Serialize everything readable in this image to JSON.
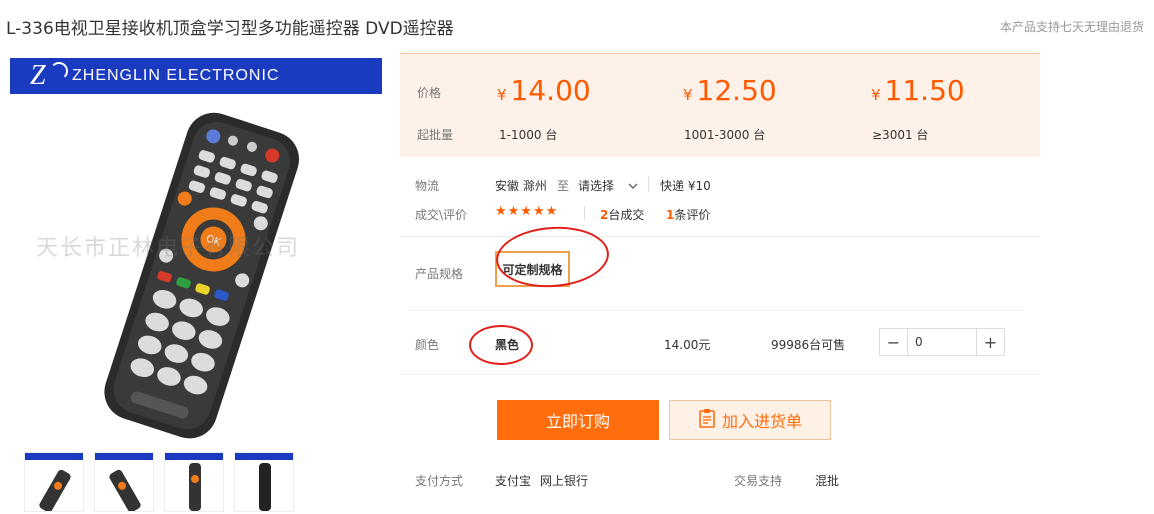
{
  "product": {
    "title": "L-336电视卫星接收机顶盒学习型多功能遥控器 DVD遥控器",
    "notice": "本产品支持七天无理由退货"
  },
  "gallery": {
    "brand": "ZHENGLIN ELECTRONIC",
    "watermark": "天长市正林电子有限公司"
  },
  "pricing": {
    "price_label": "价格",
    "moq_label": "起批量",
    "currency": "¥",
    "tiers": [
      {
        "price": "14.00",
        "range": "1-1000 台"
      },
      {
        "price": "12.50",
        "range": "1001-3000 台"
      },
      {
        "price": "11.50",
        "range": "≥3001 台"
      }
    ]
  },
  "logistics": {
    "label": "物流",
    "origin": "安徽 滁州",
    "to": "至",
    "destination": "请选择",
    "shipping": "快递 ¥10"
  },
  "trade": {
    "label": "成交\\评价",
    "stars": "★★★★★",
    "deals_count": "2",
    "deals_text": "台成交",
    "reviews_count": "1",
    "reviews_text": "条评价"
  },
  "spec": {
    "label": "产品规格",
    "option": "可定制规格"
  },
  "color_row": {
    "label": "颜色",
    "value": "黑色",
    "price": "14.00元",
    "stock": "99986台可售",
    "quantity": "0",
    "minus": "−",
    "plus": "+"
  },
  "actions": {
    "buy": "立即订购",
    "cart": "加入进货单"
  },
  "payment": {
    "label": "支付方式",
    "methods": [
      "支付宝",
      "网上银行"
    ],
    "support_label": "交易支持",
    "support_value": "混批"
  },
  "colors": {
    "accent": "#ff6d0d",
    "price": "#ff5a00",
    "brand_blue": "#1a3bbf",
    "annotation_red": "#e0201a"
  }
}
